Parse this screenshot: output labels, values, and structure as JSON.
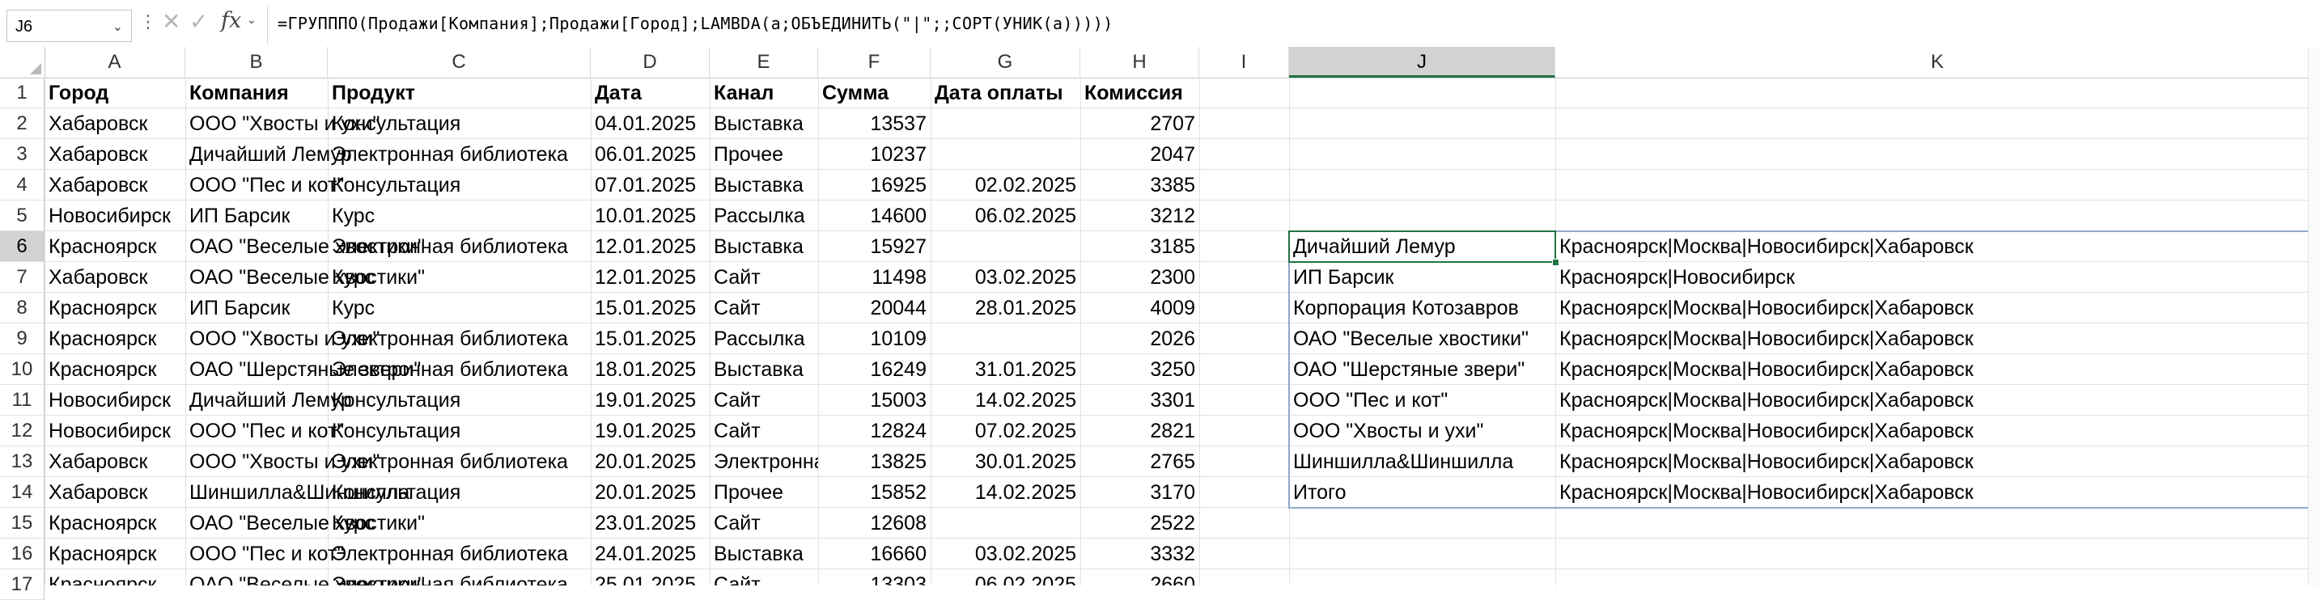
{
  "formula_bar": {
    "name_box": "J6",
    "name_box_arrow": "⌄",
    "dots": "⋮",
    "cancel": "✕",
    "enter": "✓",
    "fx": "fx",
    "fx_arrow": "⌄",
    "formula": "=ГРУПППО(Продажи[Компания];Продажи[Город];LAMBDA(a;ОБЪЕДИНИТЬ(\"|\";;СОРТ(УНИК(a)))))"
  },
  "columns": [
    "A",
    "B",
    "C",
    "D",
    "E",
    "F",
    "G",
    "H",
    "I",
    "J",
    "K"
  ],
  "selected_column": "J",
  "rows": [
    "1",
    "2",
    "3",
    "4",
    "5",
    "6",
    "7",
    "8",
    "9",
    "10",
    "11",
    "12",
    "13",
    "14",
    "15",
    "16",
    "17"
  ],
  "selected_row": "6",
  "headers": [
    "Город",
    "Компания",
    "Продукт",
    "Дата",
    "Канал",
    "Сумма",
    "Дата оплаты",
    "Комиссия"
  ],
  "table": [
    [
      "Хабаровск",
      "ООО \"Хвосты и ухи\"",
      "Консультация",
      "04.01.2025",
      "Выставка",
      "13537",
      "",
      "2707"
    ],
    [
      "Хабаровск",
      "Дичайший Лемур",
      "Электронная библиотека",
      "06.01.2025",
      "Прочее",
      "10237",
      "",
      "2047"
    ],
    [
      "Хабаровск",
      "ООО \"Пес и кот\"",
      "Консультация",
      "07.01.2025",
      "Выставка",
      "16925",
      "02.02.2025",
      "3385"
    ],
    [
      "Новосибирск",
      "ИП Барсик",
      "Курс",
      "10.01.2025",
      "Рассылка",
      "14600",
      "06.02.2025",
      "3212"
    ],
    [
      "Красноярск",
      "ОАО \"Веселые хвостики\"",
      "Электронная библиотека",
      "12.01.2025",
      "Выставка",
      "15927",
      "",
      "3185"
    ],
    [
      "Хабаровск",
      "ОАО \"Веселые хвостики\"",
      "Курс",
      "12.01.2025",
      "Сайт",
      "11498",
      "03.02.2025",
      "2300"
    ],
    [
      "Красноярск",
      "ИП Барсик",
      "Курс",
      "15.01.2025",
      "Сайт",
      "20044",
      "28.01.2025",
      "4009"
    ],
    [
      "Красноярск",
      "ООО \"Хвосты и ухи\"",
      "Электронная библиотека",
      "15.01.2025",
      "Рассылка",
      "10109",
      "",
      "2026"
    ],
    [
      "Красноярск",
      "ОАО \"Шерстяные звери\"",
      "Электронная библиотека",
      "18.01.2025",
      "Выставка",
      "16249",
      "31.01.2025",
      "3250"
    ],
    [
      "Новосибирск",
      "Дичайший Лемур",
      "Консультация",
      "19.01.2025",
      "Сайт",
      "15003",
      "14.02.2025",
      "3301"
    ],
    [
      "Новосибирск",
      "ООО \"Пес и кот\"",
      "Консультация",
      "19.01.2025",
      "Сайт",
      "12824",
      "07.02.2025",
      "2821"
    ],
    [
      "Хабаровск",
      "ООО \"Хвосты и ухи\"",
      "Электронная библиотека",
      "20.01.2025",
      "Электронная библиотека",
      "13825",
      "30.01.2025",
      "2765"
    ],
    [
      "Хабаровск",
      "Шиншилла&Шиншилла",
      "Консультация",
      "20.01.2025",
      "Прочее",
      "15852",
      "14.02.2025",
      "3170"
    ],
    [
      "Красноярск",
      "ОАО \"Веселые хвостики\"",
      "Курс",
      "23.01.2025",
      "Сайт",
      "12608",
      "",
      "2522"
    ],
    [
      "Красноярск",
      "ООО \"Пес и кот\"",
      "Электронная библиотека",
      "24.01.2025",
      "Выставка",
      "16660",
      "03.02.2025",
      "3332"
    ],
    [
      "Красноярск",
      "ОАО \"Веселые хвостики\"",
      "Электронная библиотека",
      "25.01.2025",
      "Сайт",
      "13303",
      "06.02.2025",
      "2660"
    ]
  ],
  "spill": [
    [
      "Дичайший Лемур",
      "Красноярск|Москва|Новосибирск|Хабаровск"
    ],
    [
      "ИП Барсик",
      "Красноярск|Новосибирск"
    ],
    [
      "Корпорация Котозавров",
      "Красноярск|Москва|Новосибирск|Хабаровск"
    ],
    [
      "ОАО \"Веселые хвостики\"",
      "Красноярск|Москва|Новосибирск|Хабаровск"
    ],
    [
      "ОАО \"Шерстяные звери\"",
      "Красноярск|Москва|Новосибирск|Хабаровск"
    ],
    [
      "ООО \"Пес и кот\"",
      "Красноярск|Москва|Новосибирск|Хабаровск"
    ],
    [
      "ООО \"Хвосты и ухи\"",
      "Красноярск|Москва|Новосибирск|Хабаровск"
    ],
    [
      "Шиншилла&Шиншилла",
      "Красноярск|Москва|Новосибирск|Хабаровск"
    ],
    [
      "Итого",
      "Красноярск|Москва|Новосибирск|Хабаровск"
    ]
  ],
  "colors": {
    "accent": "#217346",
    "spill_border": "#8fa8c8",
    "header_selected": "#d2d2d2"
  }
}
